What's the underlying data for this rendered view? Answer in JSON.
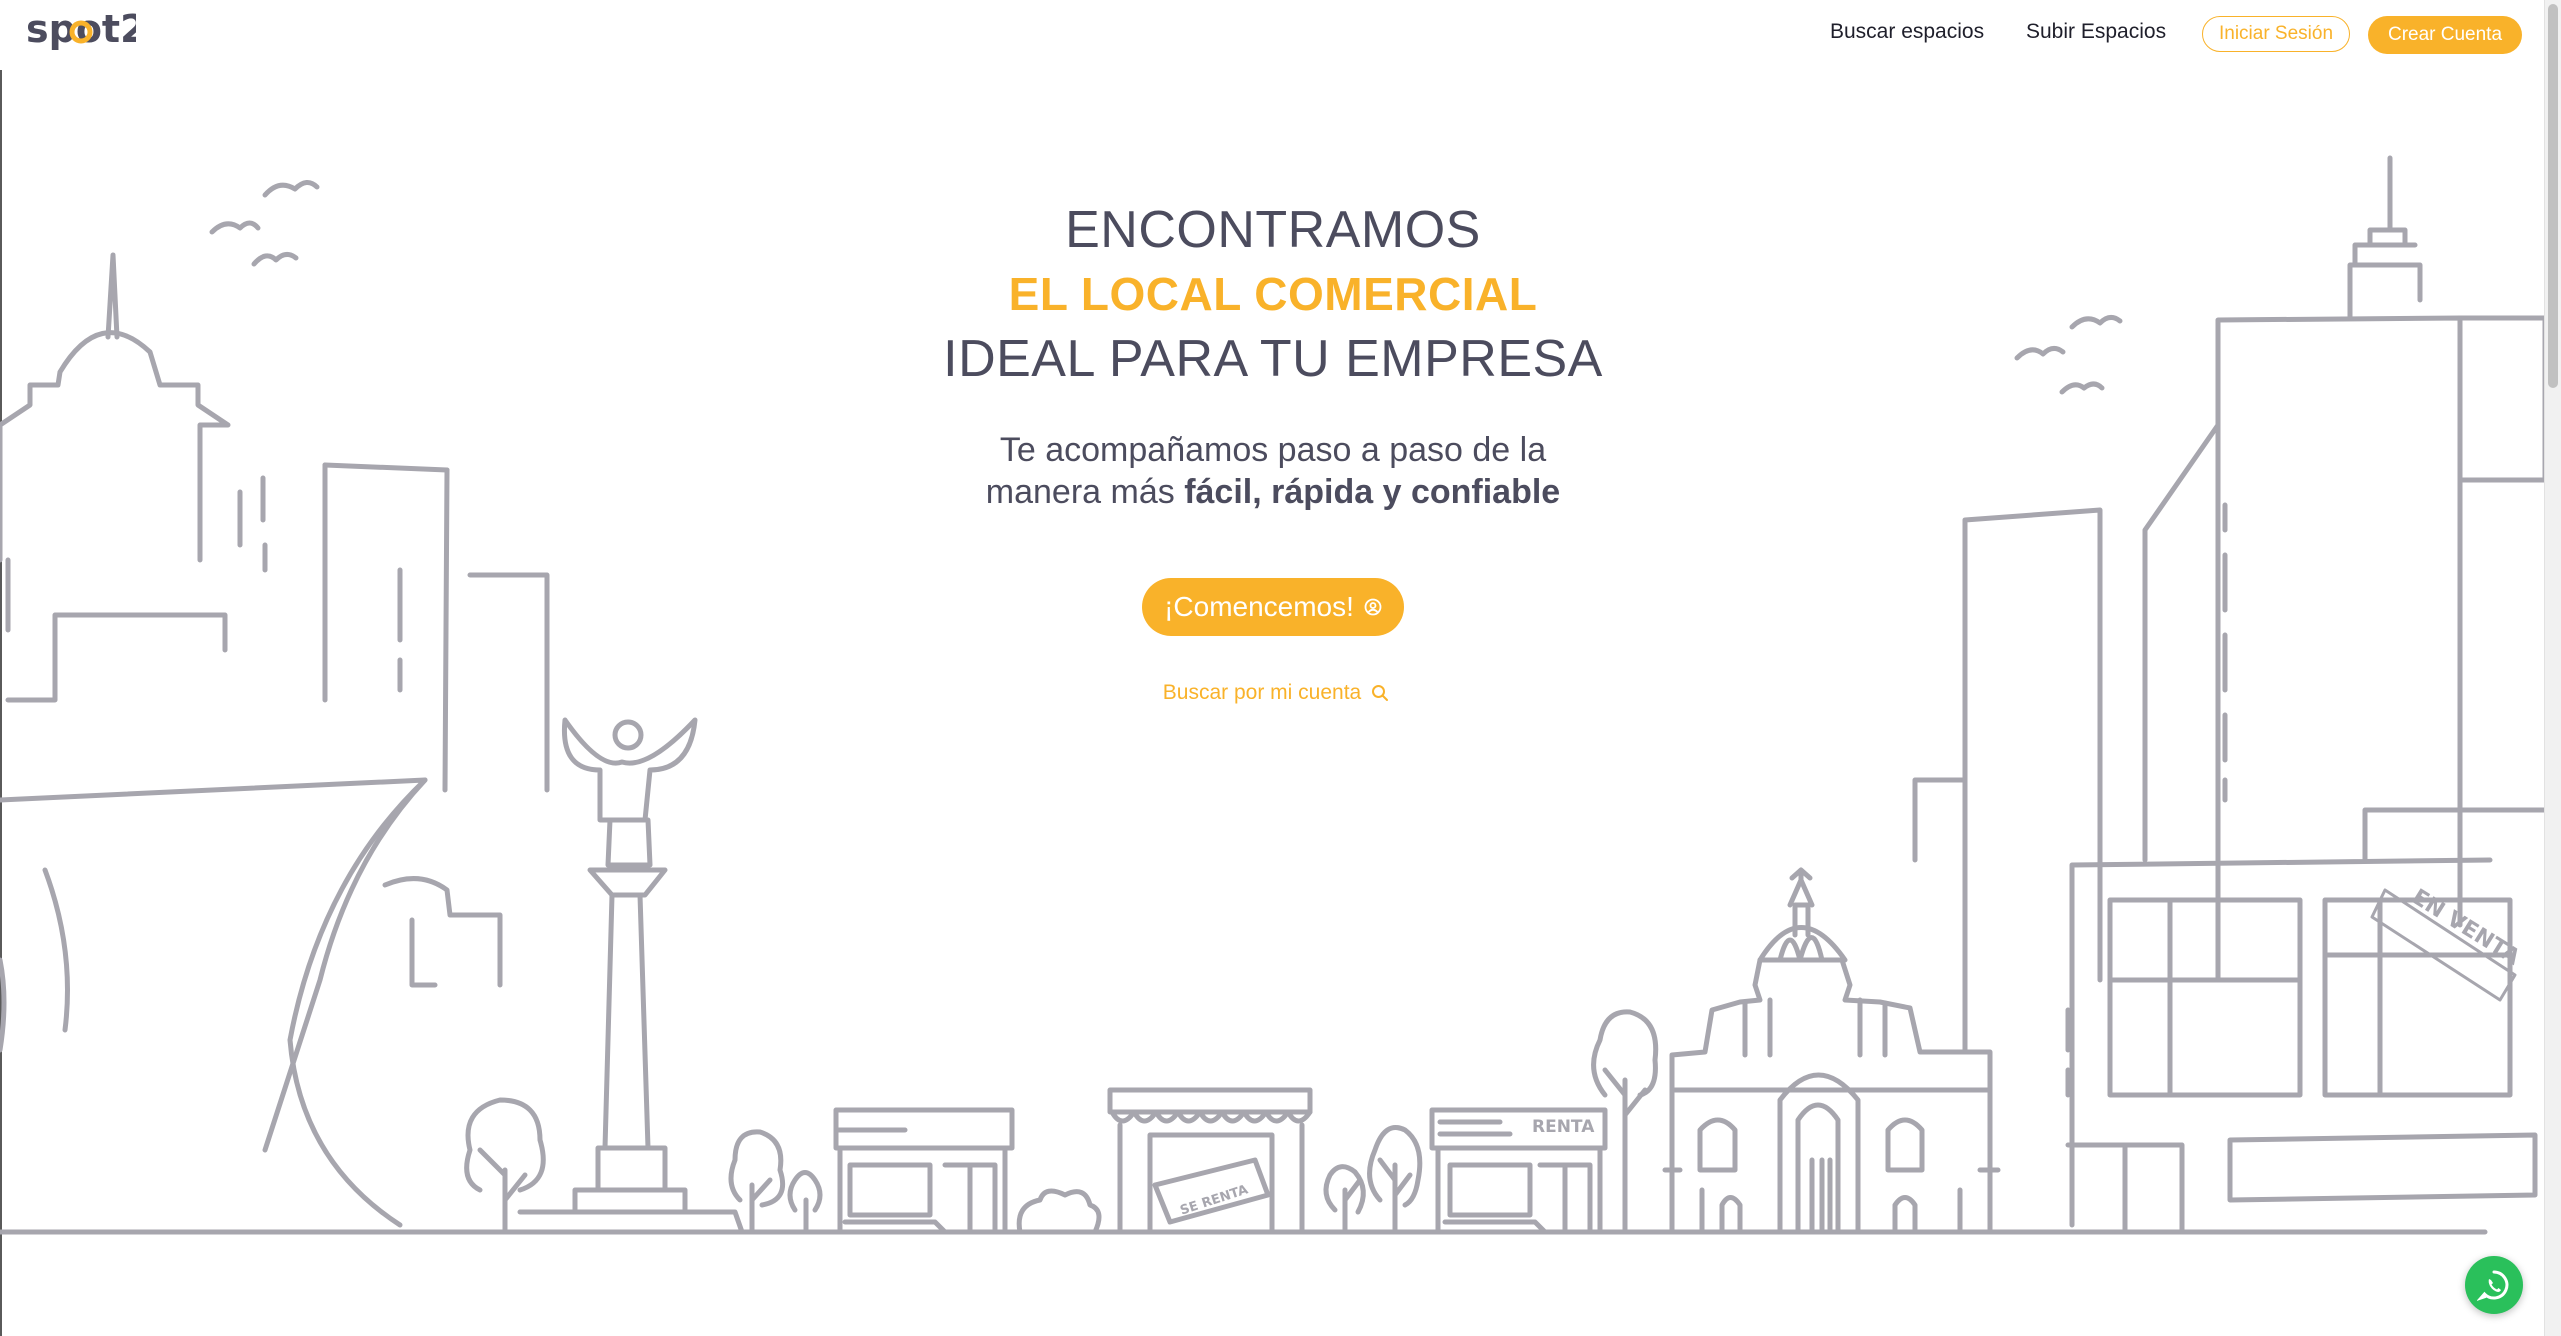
{
  "header": {
    "logo_text": "spot2",
    "nav": {
      "search_spaces": "Buscar espacios",
      "upload_spaces": "Subir Espacios"
    },
    "login_label": "Iniciar Sesión",
    "signup_label": "Crear Cuenta"
  },
  "hero": {
    "line1": "ENCONTRAMOS",
    "line2": "EL LOCAL COMERCIAL",
    "line3": "IDEAL PARA TU EMPRESA",
    "subtitle_plain": "Te acompañamos paso a paso de la manera más ",
    "subtitle_bold": "fácil, rápida y confiable",
    "cta_label": "¡Comencemos!",
    "search_link_label": "Buscar por mi cuenta"
  },
  "illustration": {
    "sign_for_sale": "EN VENTA",
    "sign_rent_1": "RENTA",
    "sign_rent_2": "SE RENTA"
  },
  "colors": {
    "accent": "#f9b22a",
    "text": "#4c4c5e",
    "illustration_stroke": "#a7a6ae",
    "whatsapp": "#2ac05b"
  },
  "icons": {
    "cta": "user-circle-icon",
    "search": "search-icon",
    "chat": "whatsapp-icon"
  }
}
